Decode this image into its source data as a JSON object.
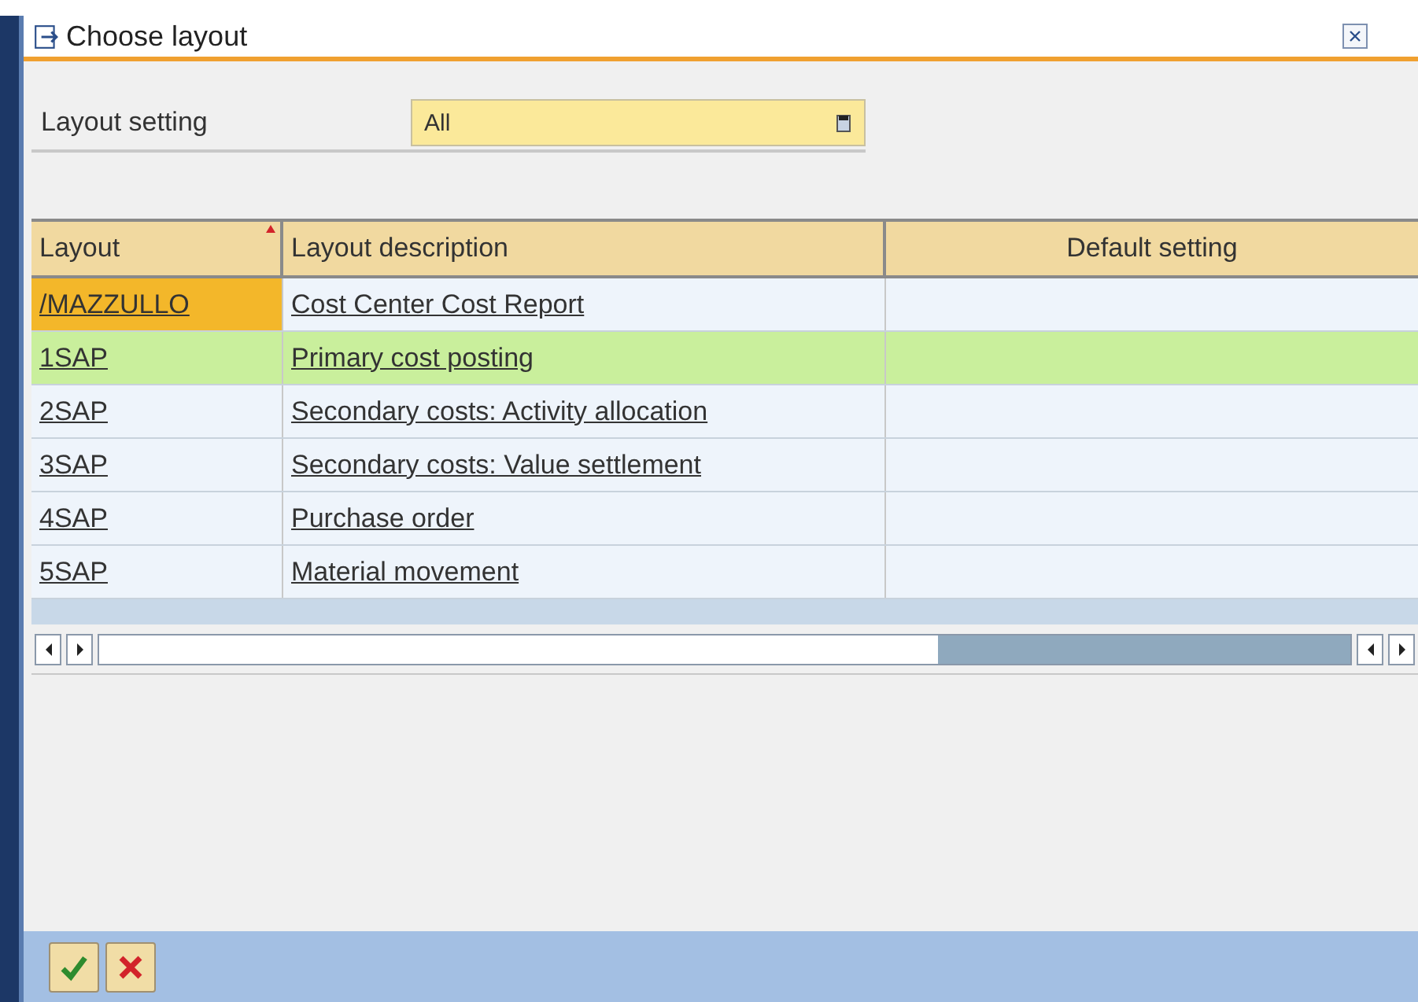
{
  "window": {
    "title": "Choose layout"
  },
  "layout_setting": {
    "label": "Layout setting",
    "value": "All"
  },
  "table": {
    "columns": [
      {
        "label": "Layout",
        "sorted": true
      },
      {
        "label": "Layout description",
        "sorted": false
      },
      {
        "label": "Default setting",
        "sorted": false
      }
    ],
    "rows": [
      {
        "layout": "/MAZZULLO",
        "description": "Cost Center Cost Report",
        "selected": false,
        "focused": true
      },
      {
        "layout": "1SAP",
        "description": "Primary cost posting",
        "selected": true,
        "focused": false
      },
      {
        "layout": "2SAP",
        "description": "Secondary costs: Activity allocation",
        "selected": false,
        "focused": false
      },
      {
        "layout": "3SAP",
        "description": "Secondary costs: Value settlement",
        "selected": false,
        "focused": false
      },
      {
        "layout": "4SAP",
        "description": "Purchase order",
        "selected": false,
        "focused": false
      },
      {
        "layout": "5SAP",
        "description": "Material movement",
        "selected": false,
        "focused": false
      }
    ]
  }
}
